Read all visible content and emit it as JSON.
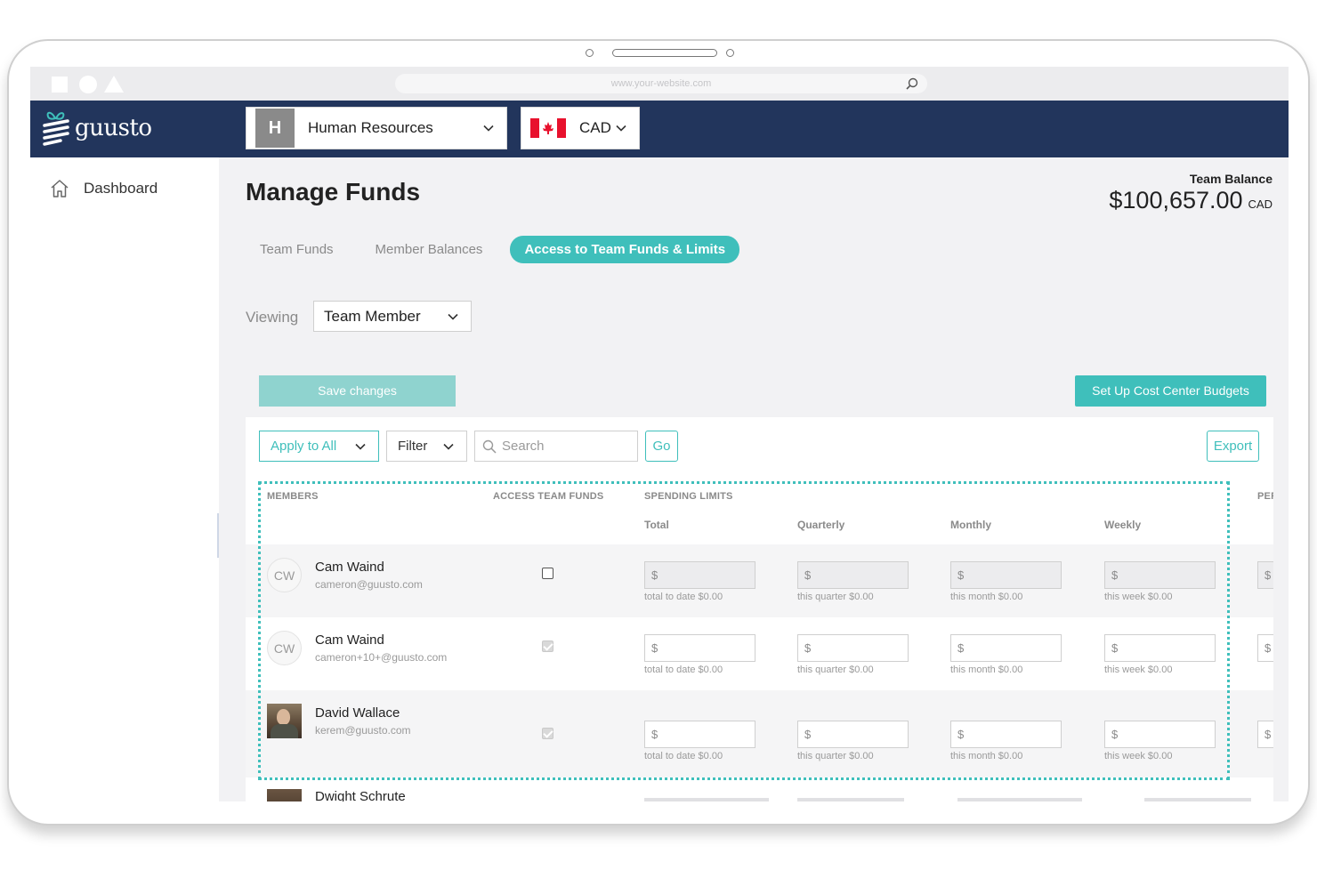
{
  "browser": {
    "url": "www.your-website.com"
  },
  "topnav": {
    "brand": "guusto",
    "department": {
      "initial": "H",
      "label": "Human Resources"
    },
    "currency": {
      "label": "CAD"
    }
  },
  "sidebar": {
    "items": [
      {
        "label": "Dashboard"
      }
    ]
  },
  "page": {
    "title": "Manage Funds",
    "balance_label": "Team Balance",
    "balance_value": "$100,657.00",
    "balance_currency": "CAD"
  },
  "tabs": [
    {
      "label": "Team Funds"
    },
    {
      "label": "Member Balances"
    },
    {
      "label": "Access to Team Funds & Limits"
    }
  ],
  "viewing": {
    "label": "Viewing",
    "value": "Team Member"
  },
  "actions": {
    "save": "Save changes",
    "cost_center": "Set Up Cost Center Budgets"
  },
  "toolbar": {
    "apply": "Apply to All",
    "filter": "Filter",
    "search_placeholder": "Search",
    "go": "Go",
    "export": "Export"
  },
  "table": {
    "headers": {
      "members": "MEMBERS",
      "access": "ACCESS TEAM FUNDS",
      "limits": "SPENDING LIMITS",
      "per": "PER"
    },
    "subheaders": [
      "Total",
      "Quarterly",
      "Monthly",
      "Weekly"
    ],
    "currency_symbol": "$",
    "rows": [
      {
        "initials": "CW",
        "name": "Cam Waind",
        "email": "cameron@guusto.com",
        "access": false,
        "notes": [
          "total to date $0.00",
          "this quarter $0.00",
          "this month $0.00",
          "this week $0.00"
        ]
      },
      {
        "initials": "CW",
        "name": "Cam Waind",
        "email": "cameron+10+@guusto.com",
        "access": true,
        "notes": [
          "total to date $0.00",
          "this quarter $0.00",
          "this month $0.00",
          "this week $0.00"
        ]
      },
      {
        "initials": "",
        "name": "David Wallace",
        "email": "kerem@guusto.com",
        "access": true,
        "notes": [
          "total to date $0.00",
          "this quarter $0.00",
          "this month $0.00",
          "this week $0.00"
        ]
      }
    ],
    "peek_row_name": "Dwight Schrute"
  },
  "colors": {
    "accent": "#3fbfbb",
    "navy": "#22355c",
    "accent_light": "#8fd3cf"
  }
}
